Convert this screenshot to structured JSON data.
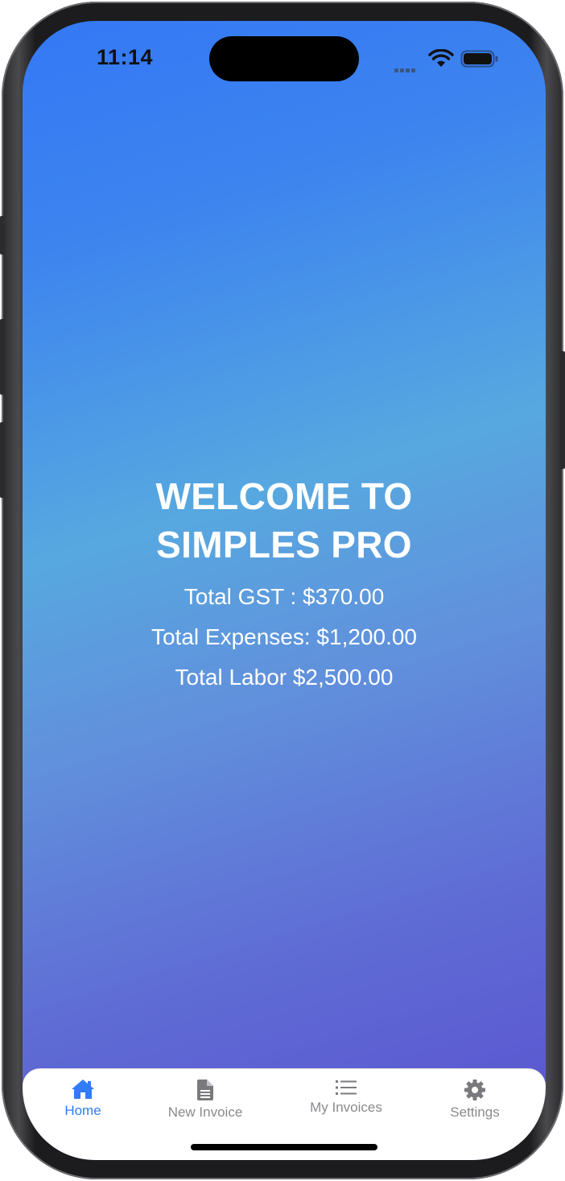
{
  "status_bar": {
    "time": "11:14"
  },
  "main": {
    "title_line1": "WELCOME TO",
    "title_line2": "SIMPLES PRO",
    "total_gst": "Total GST : $370.00",
    "total_expenses": "Total Expenses: $1,200.00",
    "total_labor": "Total Labor $2,500.00"
  },
  "tabbar": {
    "tabs": [
      {
        "label": "Home",
        "icon": "house-icon",
        "active": true
      },
      {
        "label": "New Invoice",
        "icon": "document-icon",
        "active": false
      },
      {
        "label": "My Invoices",
        "icon": "list-icon",
        "active": false
      },
      {
        "label": "Settings",
        "icon": "gear-icon",
        "active": false
      }
    ]
  },
  "colors": {
    "accent": "#2f7cf6",
    "gradient_top": "#3478f5",
    "gradient_mid": "#57a8e0",
    "gradient_bottom": "#5a52cf",
    "tab_inactive": "#8a8a8e"
  }
}
